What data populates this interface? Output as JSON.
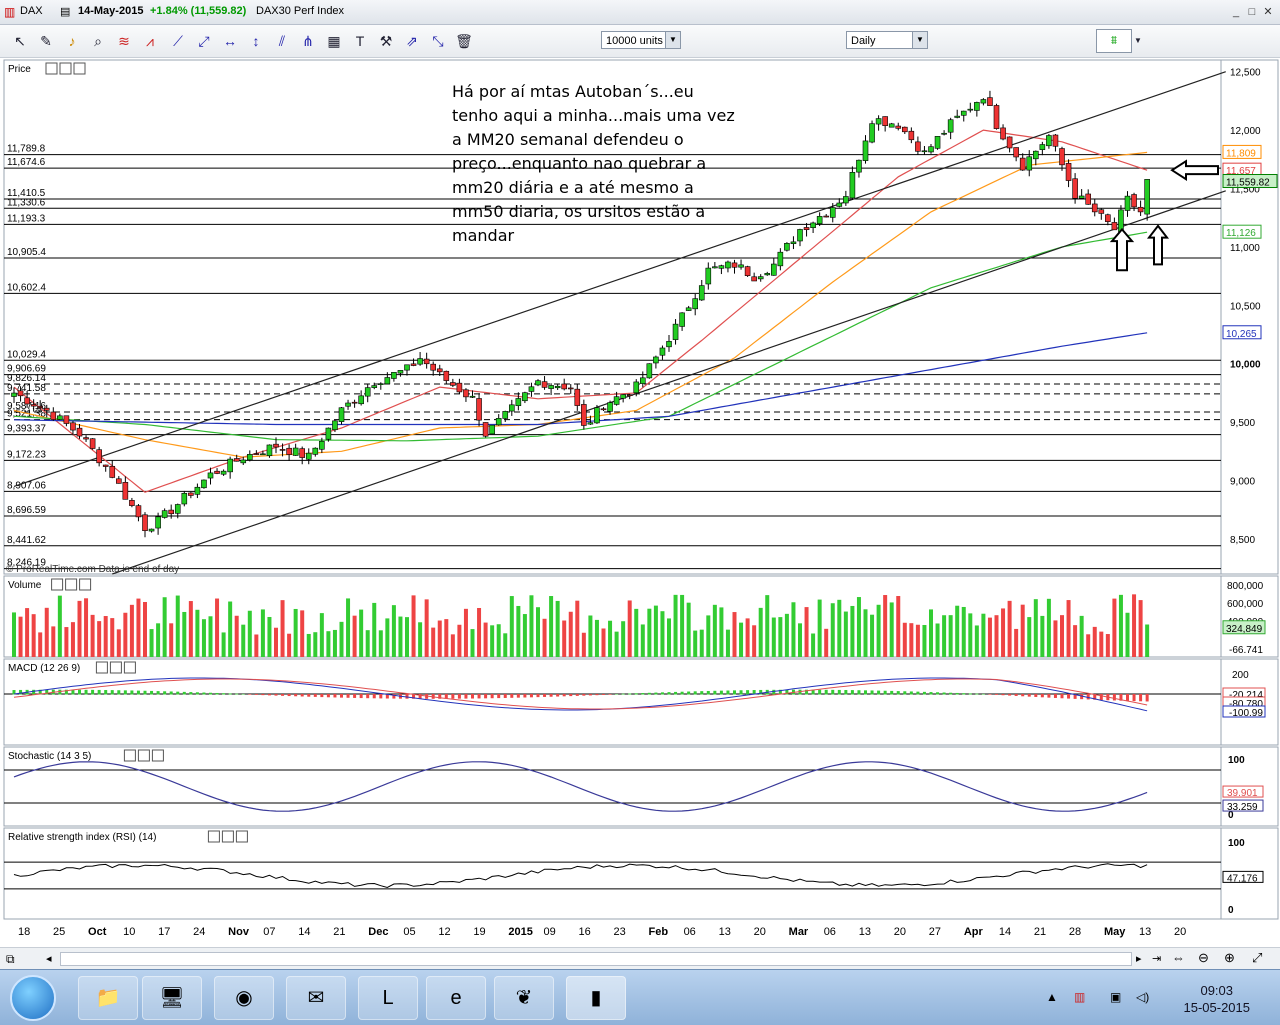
{
  "titlebar": {
    "symbol": "DAX",
    "date": "14-May-2015",
    "change": "+1.84% (11,559.82)",
    "name": "DAX30 Perf Index",
    "colors": {
      "change": "#009900"
    }
  },
  "toolbar": {
    "units": "10000 units",
    "period": "Daily",
    "icons": [
      "cursor-icon",
      "pencil-icon",
      "bell-icon",
      "zoom-icon",
      "fibonacci-icon",
      "zigzag-icon",
      "trendline-icon",
      "ray-icon",
      "horizontal-line-icon",
      "vertical-line-icon",
      "channel-icon",
      "pitchfork-icon",
      "gann-icon",
      "text-icon",
      "tools-icon",
      "arrows-icon",
      "trash-icon"
    ]
  },
  "panels": {
    "price": "Price",
    "volume": "Volume",
    "macd": "MACD (12 26 9)",
    "stochastic": "Stochastic (14 3 5)",
    "rsi": "Relative strength index (RSI) (14)"
  },
  "watermark": "© ProRealTime.com  Data is end of day",
  "annotation_lines": [
    "Há por aí mtas Autoban´s...eu",
    "tenho aqui a minha...mais uma vez",
    "a MM20 semanal defendeu o",
    "preço...enquanto nao quebrar a",
    "mm20 diária e a até mesmo a",
    "mm50 diaria, os ursitos estão a",
    "mandar"
  ],
  "taskbar": {
    "time": "09:03",
    "date": "15-05-2015",
    "apps": [
      "explorer-icon",
      "terminal-icon",
      "chrome-icon",
      "outlook-icon",
      "lync-icon",
      "ie-icon",
      "app-icon",
      "chart-app-icon"
    ]
  },
  "chart_data": {
    "type": "candlestick",
    "price_axis": {
      "ticks": [
        "12,500",
        "12,000",
        "11,500",
        "11,000",
        "10,500",
        "10,000",
        "9,500",
        "9,000",
        "8,500"
      ],
      "range": [
        8200,
        12600
      ],
      "labels": [
        {
          "text": "11,809",
          "value": 11809,
          "color": "#ff8c00"
        },
        {
          "text": "11,657",
          "value": 11657,
          "color": "#e04040"
        },
        {
          "text": "11,559.82",
          "value": 11559.82,
          "color": "#008000"
        },
        {
          "text": "11,126",
          "value": 11126,
          "color": "#33aa33"
        },
        {
          "text": "10,265",
          "value": 10265,
          "color": "#2233bb"
        }
      ]
    },
    "horizontal_levels": [
      {
        "text": "11,789.8",
        "value": 11789.8
      },
      {
        "text": "11,674.6",
        "value": 11674.6
      },
      {
        "text": "11,410.5",
        "value": 11410.5
      },
      {
        "text": "11,330.6",
        "value": 11330.6
      },
      {
        "text": "11,193.3",
        "value": 11193.3
      },
      {
        "text": "10,905.4",
        "value": 10905.4
      },
      {
        "text": "10,602.4",
        "value": 10602.4
      },
      {
        "text": "10,029.4",
        "value": 10029.4
      },
      {
        "text": "9,906.69",
        "value": 9906.69
      },
      {
        "text": "9,826.14",
        "value": 9826.14
      },
      {
        "text": "9,741.58",
        "value": 9741.58
      },
      {
        "text": "9,587.16",
        "value": 9587.16
      },
      {
        "text": "9,521.38",
        "value": 9521.38
      },
      {
        "text": "9,393.37",
        "value": 9393.37
      },
      {
        "text": "9,172.23",
        "value": 9172.23
      },
      {
        "text": "8,907.06",
        "value": 8907.06
      },
      {
        "text": "8,696.59",
        "value": 8696.59
      },
      {
        "text": "8,441.62",
        "value": 8441.62
      },
      {
        "text": "8,246.19",
        "value": 8246.19
      }
    ],
    "x_labels": [
      "18",
      "25",
      "Oct",
      "10",
      "17",
      "24",
      "Nov",
      "07",
      "14",
      "21",
      "Dec",
      "05",
      "12",
      "19",
      "2015",
      "09",
      "16",
      "23",
      "Feb",
      "06",
      "13",
      "20",
      "Mar",
      "06",
      "13",
      "20",
      "27",
      "Apr",
      "14",
      "21",
      "28",
      "May",
      "13",
      "20"
    ],
    "close_anchors": [
      [
        0,
        9750
      ],
      [
        5,
        9600
      ],
      [
        10,
        9400
      ],
      [
        15,
        9050
      ],
      [
        20,
        8600
      ],
      [
        22,
        8650
      ],
      [
        25,
        8800
      ],
      [
        30,
        9050
      ],
      [
        35,
        9200
      ],
      [
        40,
        9300
      ],
      [
        45,
        9200
      ],
      [
        50,
        9600
      ],
      [
        55,
        9850
      ],
      [
        60,
        9950
      ],
      [
        62,
        10050
      ],
      [
        65,
        9900
      ],
      [
        70,
        9700
      ],
      [
        72,
        9400
      ],
      [
        75,
        9550
      ],
      [
        80,
        9850
      ],
      [
        85,
        9800
      ],
      [
        87,
        9450
      ],
      [
        90,
        9650
      ],
      [
        95,
        9800
      ],
      [
        98,
        10050
      ],
      [
        102,
        10400
      ],
      [
        106,
        10800
      ],
      [
        110,
        10850
      ],
      [
        113,
        10750
      ],
      [
        116,
        10850
      ],
      [
        120,
        11150
      ],
      [
        124,
        11300
      ],
      [
        127,
        11450
      ],
      [
        131,
        12100
      ],
      [
        135,
        12050
      ],
      [
        139,
        11800
      ],
      [
        143,
        12050
      ],
      [
        148,
        12300
      ],
      [
        150,
        12050
      ],
      [
        154,
        11700
      ],
      [
        158,
        11950
      ],
      [
        162,
        11450
      ],
      [
        165,
        11300
      ],
      [
        168,
        11150
      ],
      [
        170,
        11400
      ],
      [
        172,
        11300
      ],
      [
        173,
        11560
      ]
    ],
    "ma_anchors": {
      "sma20": [
        [
          0,
          9800
        ],
        [
          20,
          8900
        ],
        [
          35,
          9200
        ],
        [
          50,
          9450
        ],
        [
          65,
          9800
        ],
        [
          80,
          9700
        ],
        [
          95,
          9750
        ],
        [
          105,
          10200
        ],
        [
          120,
          10900
        ],
        [
          135,
          11600
        ],
        [
          148,
          12000
        ],
        [
          160,
          11900
        ],
        [
          173,
          11657
        ]
      ],
      "sma50": [
        [
          0,
          9600
        ],
        [
          20,
          9350
        ],
        [
          35,
          9200
        ],
        [
          50,
          9250
        ],
        [
          65,
          9450
        ],
        [
          80,
          9480
        ],
        [
          95,
          9600
        ],
        [
          110,
          10050
        ],
        [
          125,
          10700
        ],
        [
          140,
          11300
        ],
        [
          155,
          11700
        ],
        [
          173,
          11809
        ]
      ],
      "sma100": [
        [
          0,
          9550
        ],
        [
          20,
          9480
        ],
        [
          40,
          9350
        ],
        [
          60,
          9340
        ],
        [
          80,
          9380
        ],
        [
          100,
          9550
        ],
        [
          120,
          10100
        ],
        [
          140,
          10650
        ],
        [
          160,
          11000
        ],
        [
          173,
          11126
        ]
      ],
      "sma200": [
        [
          0,
          9520
        ],
        [
          40,
          9480
        ],
        [
          80,
          9480
        ],
        [
          100,
          9550
        ],
        [
          120,
          9750
        ],
        [
          140,
          9950
        ],
        [
          160,
          10150
        ],
        [
          173,
          10265
        ]
      ]
    },
    "trendlines": [
      {
        "from": [
          0,
          8950
        ],
        "to": [
          185,
          12500
        ]
      },
      {
        "from": [
          15,
          8200
        ],
        "to": [
          185,
          11480
        ]
      }
    ],
    "annotated_levels_right": {
      "arrow_left_at": 11657
    },
    "volume_axis": {
      "ticks": [
        "800,000",
        "600,000",
        "400,000"
      ],
      "labels": [
        "324,849"
      ]
    },
    "macd_axis": {
      "ticks": [
        "200",
        "0"
      ],
      "labels": [
        "-20.214",
        "-80.780",
        "-100.99"
      ]
    },
    "stochastic_axis": {
      "ticks": [
        "100",
        "0"
      ],
      "labels": [
        "39.901",
        "33.259"
      ]
    },
    "rsi_axis": {
      "ticks": [
        "100",
        "0"
      ],
      "labels": [
        "47.176"
      ]
    }
  }
}
